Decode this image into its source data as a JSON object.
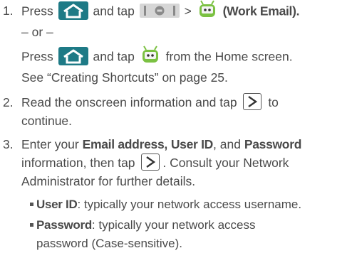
{
  "step1": {
    "number": "1.",
    "line1_press": "Press",
    "line1_and_tap": "and tap",
    "line1_gt": ">",
    "line1_label": "(Work Email).",
    "or": "– or –",
    "line3_press": "Press",
    "line3_and_tap": "and tap",
    "line3_rest": "from the Home screen.",
    "line4": "See “Creating Shortcuts” on page 25.",
    "icons": [
      "home-icon",
      "applications-icon",
      "work-email-robot-icon"
    ]
  },
  "step2": {
    "number": "2.",
    "line1_a": "Read the onscreen information and tap",
    "line1_b": "to",
    "line2": "continue."
  },
  "step3": {
    "number": "3.",
    "enter": "Enter your",
    "email": "Email address,",
    "userid": "User ID",
    "and": ", and",
    "password": "Password",
    "line2_a": "information, then tap",
    "line2_b": ". Consult your Network",
    "line3": "Administrator for further details."
  },
  "bullets": [
    {
      "term": "User ID",
      "desc": ": typically your network access username."
    },
    {
      "term": "Password",
      "desc": ": typically your network access",
      "cont": "password (Case-sensitive)."
    }
  ],
  "colors": {
    "text": "#4a4a4a",
    "home_icon_bg": "#1e7a86",
    "robot_green": "#7bc142"
  }
}
